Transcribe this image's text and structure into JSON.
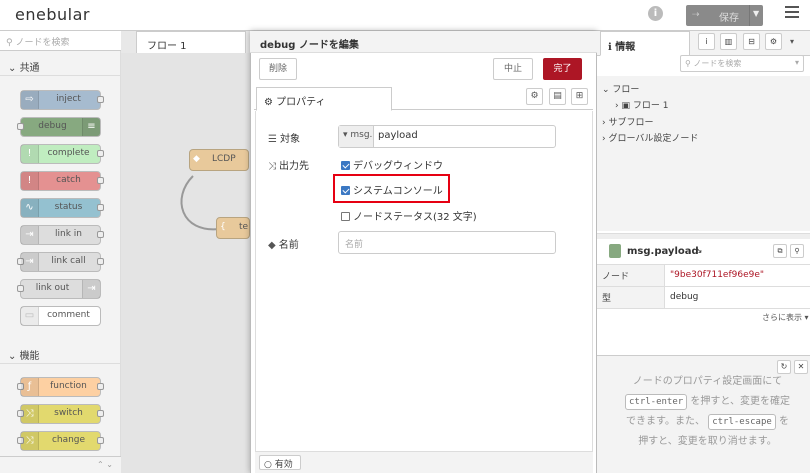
{
  "header": {
    "logo": "enebular",
    "deploy_label": "保存",
    "deploy_icon": "deploy-icon"
  },
  "palette": {
    "search_placeholder": "ノードを検索",
    "categories": [
      {
        "label": "共通"
      },
      {
        "label": "機能"
      }
    ],
    "common_nodes": [
      {
        "label": "inject",
        "color": "#a6bbcf"
      },
      {
        "label": "debug",
        "color": "#87a980"
      },
      {
        "label": "complete",
        "color": "#c0edc0"
      },
      {
        "label": "catch",
        "color": "#e49191"
      },
      {
        "label": "status",
        "color": "#94c1d0"
      },
      {
        "label": "link in",
        "color": "#dddddd"
      },
      {
        "label": "link call",
        "color": "#dddddd"
      },
      {
        "label": "link out",
        "color": "#dddddd"
      },
      {
        "label": "comment",
        "color": "#ffffff"
      }
    ],
    "function_nodes": [
      {
        "label": "function",
        "color": "#fdd0a2"
      },
      {
        "label": "switch",
        "color": "#e2d96e"
      },
      {
        "label": "change",
        "color": "#e2d96e"
      }
    ]
  },
  "workspace": {
    "tab_label": "フロー 1",
    "nodes": [
      {
        "label": "LCDP"
      },
      {
        "label": "te"
      }
    ]
  },
  "dialog": {
    "title": "debug ノードを編集",
    "delete_label": "削除",
    "cancel_label": "中止",
    "done_label": "完了",
    "tab_properties": "プロパティ",
    "target_label": "対象",
    "target_type": "msg.",
    "target_value": "payload",
    "output_label": "出力先",
    "options": [
      {
        "label": "デバッグウィンドウ",
        "checked": true
      },
      {
        "label": "システムコンソール",
        "checked": true
      },
      {
        "label": "ノードステータス(32 文字)",
        "checked": false
      }
    ],
    "name_label": "名前",
    "name_placeholder": "名前",
    "enabled_label": "有効",
    "highlight_color": "#e60012"
  },
  "sidebar": {
    "tab_info": "情報",
    "search_placeholder": "ノードを検索",
    "tree": [
      {
        "label": "フロー"
      },
      {
        "label": "フロー 1"
      },
      {
        "label": "サブフロー"
      },
      {
        "label": "グローバル設定ノード"
      }
    ],
    "msg_title": "msg.payload",
    "rows": [
      {
        "key": "ノード",
        "value": "\"9be30f711ef96e9e\""
      },
      {
        "key": "型",
        "value": "debug"
      }
    ],
    "more_label": "さらに表示",
    "help": {
      "line1": "ノードのプロパティ設定画面にて",
      "kbd1": "ctrl-enter",
      "line2": "を押すと、変更を確定",
      "line3": "できます。また、",
      "kbd2": "ctrl-escape",
      "line4": "を",
      "line5": "押すと、変更を取り消せます。"
    }
  }
}
